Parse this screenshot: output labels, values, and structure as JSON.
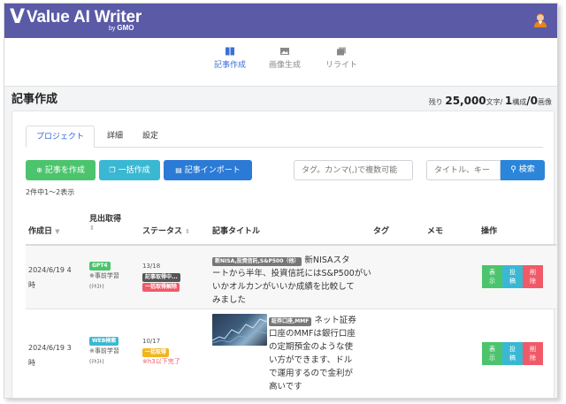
{
  "brand": {
    "name": "Value AI Writer",
    "sub_prefix": "by",
    "sub_brand": "GMO"
  },
  "nav": [
    {
      "label": "記事作成",
      "icon": "book-icon"
    },
    {
      "label": "画像生成",
      "icon": "image-icon"
    },
    {
      "label": "リライト",
      "icon": "rewrite-icon"
    }
  ],
  "page": {
    "title": "記事作成",
    "remain_prefix": "残り",
    "remain_chars": "25,000",
    "remain_chars_unit": "文字/",
    "remain_compose": "1",
    "remain_compose_unit": "構成",
    "remain_images": "/0",
    "remain_images_unit": "画像"
  },
  "tabs": [
    "プロジェクト",
    "詳細",
    "設定"
  ],
  "actions": {
    "create": "記事を作成",
    "bulk": "一括作成",
    "import": "記事インポート"
  },
  "filters": {
    "tag_placeholder": "タグ。カンマ(,)で複数可能",
    "title_placeholder": "タイトル、キー",
    "search": "検索"
  },
  "count_text": "2件中1〜2表示",
  "columns": {
    "created": "作成日",
    "heading": "見出取得",
    "status": "ステータス",
    "title": "記事タイトル",
    "tag": "タグ",
    "memo": "メモ",
    "ops": "操作"
  },
  "rows": [
    {
      "date_line1": "2024/6/19 4",
      "date_line2": "時",
      "model_badge": "GPT4",
      "learning": "※事前学習",
      "learning_note": "(ﾃｷｽﾄ)",
      "progress": "13/18",
      "status_badge1": "記事取得中...",
      "status_badge2": "一括取得解除",
      "tag_label": "新NISA,投資信託,S&P500（他）",
      "title_line1": "新NISAスタ",
      "title_line2": "ートから半年、投資信託にはS&P500がい",
      "title_line3": "いかオルカンがいいか成績を比較して",
      "title_line4": "みました",
      "op_show": [
        "表",
        "示"
      ],
      "op_post": [
        "投",
        "稿"
      ],
      "op_del": [
        "削",
        "除"
      ]
    },
    {
      "date_line1": "2024/6/19 3",
      "date_line2": "時",
      "model_badge": "WEB検索",
      "learning": "※事前学習",
      "learning_note": "(ﾃｷｽﾄ)",
      "progress": "10/17",
      "status_badge1": "一括取得",
      "status_warning": "※h3以下完了",
      "tag_label": "証券口座,MMF",
      "title_line1": "ネット証券",
      "title_line2": "口座のMMFは銀行口座",
      "title_line3": "の定期預金のような使",
      "title_line4": "い方ができます、ドル",
      "title_line5": "で運用するので金利が",
      "title_line6": "高いです",
      "op_show": [
        "表",
        "示"
      ],
      "op_post": [
        "投",
        "稿"
      ],
      "op_del": [
        "削",
        "除"
      ]
    }
  ]
}
